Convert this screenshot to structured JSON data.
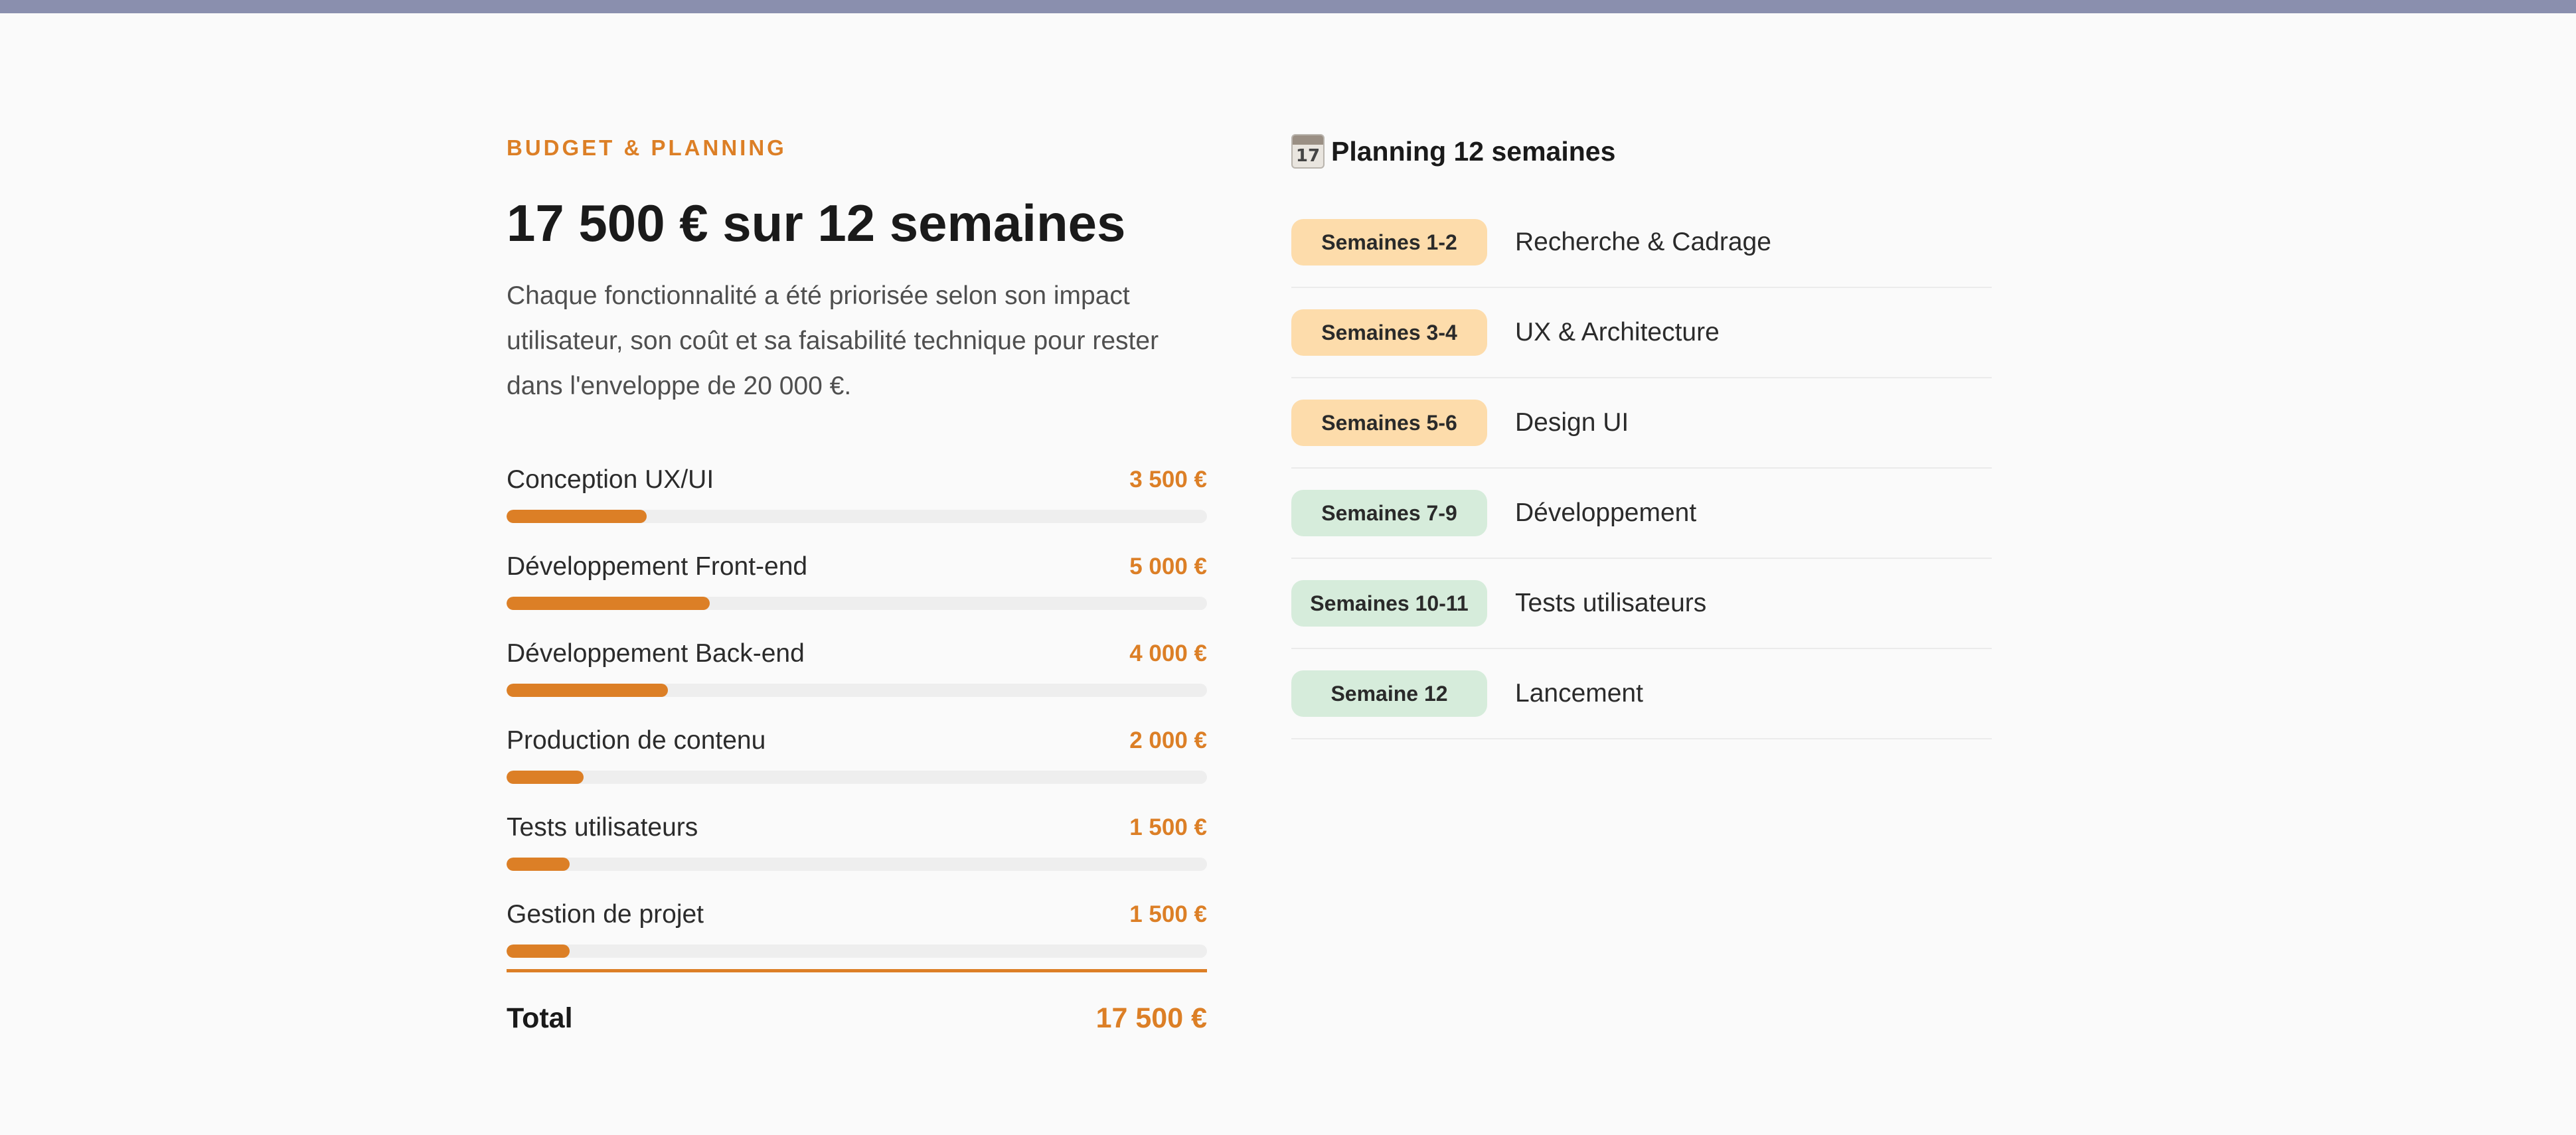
{
  "colors": {
    "accent": "#dc7f26",
    "top_bar": "#8a8fae",
    "pill_orange": "#fddcab",
    "pill_green": "#d6ecdb",
    "track": "#eeeeee",
    "background": "#fafafa"
  },
  "budget": {
    "eyebrow": "BUDGET & PLANNING",
    "title": "17 500 € sur 12 semaines",
    "description": "Chaque fonctionnalité a été priorisée selon son impact utilisateur, son coût et sa faisabilité technique pour rester dans l'enveloppe de 20 000 €.",
    "items": [
      {
        "label": "Conception UX/UI",
        "amount": "3 500 €",
        "share": 0.2
      },
      {
        "label": "Développement Front-end",
        "amount": "5 000 €",
        "share": 0.29
      },
      {
        "label": "Développement Back-end",
        "amount": "4 000 €",
        "share": 0.23
      },
      {
        "label": "Production de contenu",
        "amount": "2 000 €",
        "share": 0.11
      },
      {
        "label": "Tests utilisateurs",
        "amount": "1 500 €",
        "share": 0.09
      },
      {
        "label": "Gestion de projet",
        "amount": "1 500 €",
        "share": 0.09
      }
    ],
    "total_label": "Total",
    "total_amount": "17 500 €"
  },
  "planning": {
    "icon": "calendar-icon",
    "icon_day": "17",
    "title": "Planning 12 semaines",
    "rows": [
      {
        "weeks": "Semaines 1-2",
        "label": "Recherche & Cadrage",
        "tone": "orange"
      },
      {
        "weeks": "Semaines 3-4",
        "label": "UX & Architecture",
        "tone": "orange"
      },
      {
        "weeks": "Semaines 5-6",
        "label": "Design UI",
        "tone": "orange"
      },
      {
        "weeks": "Semaines 7-9",
        "label": "Développement",
        "tone": "green"
      },
      {
        "weeks": "Semaines 10-11",
        "label": "Tests utilisateurs",
        "tone": "green"
      },
      {
        "weeks": "Semaine 12",
        "label": "Lancement",
        "tone": "green"
      }
    ]
  }
}
